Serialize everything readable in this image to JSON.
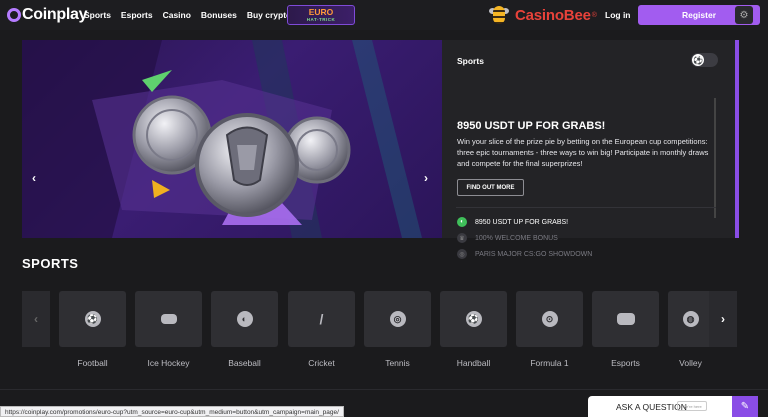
{
  "header": {
    "logo": "Coinplay",
    "nav": [
      "Sports",
      "Esports",
      "Casino",
      "Bonuses",
      "Buy crypto"
    ],
    "promo_badge": {
      "line1": "EURO",
      "line2": "HAT-TRICK"
    },
    "partner": {
      "name": "CasinoBee",
      "mark": "®"
    },
    "login": "Log in",
    "register": "Register",
    "settings_icon": "gear-icon"
  },
  "hero": {
    "prev_icon": "chevron-left-icon",
    "next_icon": "chevron-right-icon"
  },
  "promo_panel": {
    "category": "Sports",
    "title": "8950 USDT UP FOR GRABS!",
    "description": "Win your slice of the prize pie by betting on the European cup competitions: three epic tournaments - three ways to win big! Participate in monthly draws and compete for the final superprizes!",
    "button": "FIND OUT MORE",
    "list": [
      {
        "label": "8950 USDT UP FOR GRABS!",
        "active": true,
        "icon": "coin-icon"
      },
      {
        "label": "100% WELCOME BONUS",
        "active": false,
        "icon": "crown-icon"
      },
      {
        "label": "PARIS MAJOR CS:GO SHOWDOWN",
        "active": false,
        "icon": "target-icon"
      }
    ]
  },
  "sports": {
    "title": "SPORTS",
    "items": [
      {
        "label": "Football",
        "icon": "football-icon",
        "glyph": "⚽"
      },
      {
        "label": "Ice Hockey",
        "icon": "hockey-puck-icon",
        "glyph": "●"
      },
      {
        "label": "Baseball",
        "icon": "baseball-icon",
        "glyph": "◐"
      },
      {
        "label": "Cricket",
        "icon": "cricket-bat-icon",
        "glyph": "/"
      },
      {
        "label": "Tennis",
        "icon": "tennis-ball-icon",
        "glyph": "◎"
      },
      {
        "label": "Handball",
        "icon": "handball-icon",
        "glyph": "⚽"
      },
      {
        "label": "Formula 1",
        "icon": "steering-wheel-icon",
        "glyph": "⊙"
      },
      {
        "label": "Esports",
        "icon": "gamepad-icon",
        "glyph": "⌘"
      },
      {
        "label": "Volley",
        "icon": "volleyball-icon",
        "glyph": "◍"
      }
    ]
  },
  "status_url": "https://coinplay.com/promotions/euro-cup?utm_source=euro-cup&utm_medium=button&utm_campaign=main_page/",
  "ask_question": {
    "label": "ASK A QUESTION",
    "pill": "We're here"
  }
}
